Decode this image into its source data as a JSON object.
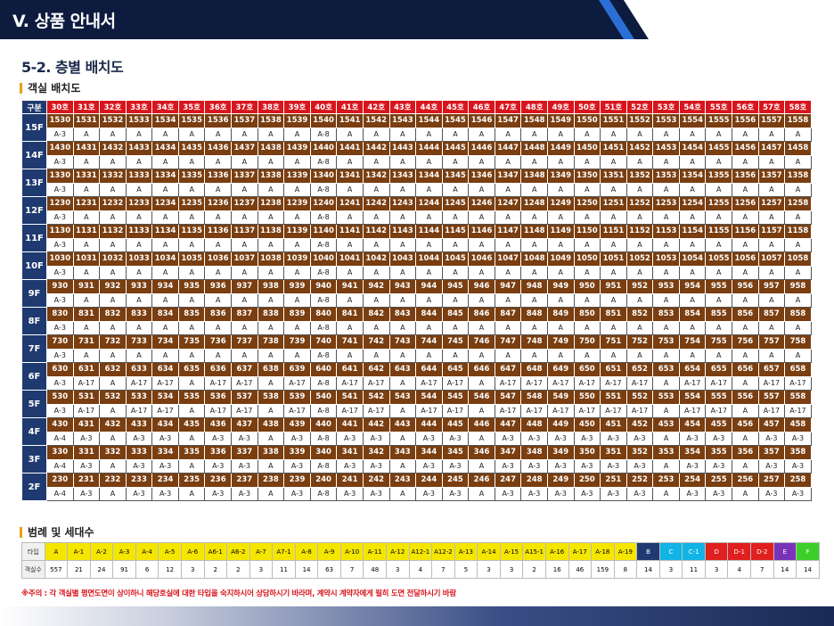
{
  "header": {
    "title": "V. 상품 안내서"
  },
  "section_title": "5-2. 층별 배치도",
  "sub_title": "객실 배치도",
  "grid": {
    "corner_label": "구분",
    "columns": [
      "30호",
      "31호",
      "32호",
      "33호",
      "34호",
      "35호",
      "36호",
      "37호",
      "38호",
      "39호",
      "40호",
      "41호",
      "42호",
      "43호",
      "44호",
      "45호",
      "46호",
      "47호",
      "48호",
      "49호",
      "50호",
      "51호",
      "52호",
      "53호",
      "54호",
      "55호",
      "56호",
      "57호",
      "58호"
    ],
    "floors": [
      {
        "floor": "15F",
        "rooms": [
          "1530",
          "1531",
          "1532",
          "1533",
          "1534",
          "1535",
          "1536",
          "1537",
          "1538",
          "1539",
          "1540",
          "1541",
          "1542",
          "1543",
          "1544",
          "1545",
          "1546",
          "1547",
          "1548",
          "1549",
          "1550",
          "1551",
          "1552",
          "1553",
          "1554",
          "1555",
          "1556",
          "1557",
          "1558"
        ],
        "types": [
          "A-3",
          "A",
          "A",
          "A",
          "A",
          "A",
          "A",
          "A",
          "A",
          "A",
          "A-8",
          "A",
          "A",
          "A",
          "A",
          "A",
          "A",
          "A",
          "A",
          "A",
          "A",
          "A",
          "A",
          "A",
          "A",
          "A",
          "A",
          "A",
          "A"
        ]
      },
      {
        "floor": "14F",
        "rooms": [
          "1430",
          "1431",
          "1432",
          "1433",
          "1434",
          "1435",
          "1436",
          "1437",
          "1438",
          "1439",
          "1440",
          "1441",
          "1442",
          "1443",
          "1444",
          "1445",
          "1446",
          "1447",
          "1448",
          "1449",
          "1450",
          "1451",
          "1452",
          "1453",
          "1454",
          "1455",
          "1456",
          "1457",
          "1458"
        ],
        "types": [
          "A-3",
          "A",
          "A",
          "A",
          "A",
          "A",
          "A",
          "A",
          "A",
          "A",
          "A-8",
          "A",
          "A",
          "A",
          "A",
          "A",
          "A",
          "A",
          "A",
          "A",
          "A",
          "A",
          "A",
          "A",
          "A",
          "A",
          "A",
          "A",
          "A"
        ]
      },
      {
        "floor": "13F",
        "rooms": [
          "1330",
          "1331",
          "1332",
          "1333",
          "1334",
          "1335",
          "1336",
          "1337",
          "1338",
          "1339",
          "1340",
          "1341",
          "1342",
          "1343",
          "1344",
          "1345",
          "1346",
          "1347",
          "1348",
          "1349",
          "1350",
          "1351",
          "1352",
          "1353",
          "1354",
          "1355",
          "1356",
          "1357",
          "1358"
        ],
        "types": [
          "A-3",
          "A",
          "A",
          "A",
          "A",
          "A",
          "A",
          "A",
          "A",
          "A",
          "A-8",
          "A",
          "A",
          "A",
          "A",
          "A",
          "A",
          "A",
          "A",
          "A",
          "A",
          "A",
          "A",
          "A",
          "A",
          "A",
          "A",
          "A",
          "A"
        ]
      },
      {
        "floor": "12F",
        "rooms": [
          "1230",
          "1231",
          "1232",
          "1233",
          "1234",
          "1235",
          "1236",
          "1237",
          "1238",
          "1239",
          "1240",
          "1241",
          "1242",
          "1243",
          "1244",
          "1245",
          "1246",
          "1247",
          "1248",
          "1249",
          "1250",
          "1251",
          "1252",
          "1253",
          "1254",
          "1255",
          "1256",
          "1257",
          "1258"
        ],
        "types": [
          "A-3",
          "A",
          "A",
          "A",
          "A",
          "A",
          "A",
          "A",
          "A",
          "A",
          "A-8",
          "A",
          "A",
          "A",
          "A",
          "A",
          "A",
          "A",
          "A",
          "A",
          "A",
          "A",
          "A",
          "A",
          "A",
          "A",
          "A",
          "A",
          "A"
        ]
      },
      {
        "floor": "11F",
        "rooms": [
          "1130",
          "1131",
          "1132",
          "1133",
          "1134",
          "1135",
          "1136",
          "1137",
          "1138",
          "1139",
          "1140",
          "1141",
          "1142",
          "1143",
          "1144",
          "1145",
          "1146",
          "1147",
          "1148",
          "1149",
          "1150",
          "1151",
          "1152",
          "1153",
          "1154",
          "1155",
          "1156",
          "1157",
          "1158"
        ],
        "types": [
          "A-3",
          "A",
          "A",
          "A",
          "A",
          "A",
          "A",
          "A",
          "A",
          "A",
          "A-8",
          "A",
          "A",
          "A",
          "A",
          "A",
          "A",
          "A",
          "A",
          "A",
          "A",
          "A",
          "A",
          "A",
          "A",
          "A",
          "A",
          "A",
          "A"
        ]
      },
      {
        "floor": "10F",
        "rooms": [
          "1030",
          "1031",
          "1032",
          "1033",
          "1034",
          "1035",
          "1036",
          "1037",
          "1038",
          "1039",
          "1040",
          "1041",
          "1042",
          "1043",
          "1044",
          "1045",
          "1046",
          "1047",
          "1048",
          "1049",
          "1050",
          "1051",
          "1052",
          "1053",
          "1054",
          "1055",
          "1056",
          "1057",
          "1058"
        ],
        "types": [
          "A-3",
          "A",
          "A",
          "A",
          "A",
          "A",
          "A",
          "A",
          "A",
          "A",
          "A-8",
          "A",
          "A",
          "A",
          "A",
          "A",
          "A",
          "A",
          "A",
          "A",
          "A",
          "A",
          "A",
          "A",
          "A",
          "A",
          "A",
          "A",
          "A"
        ]
      },
      {
        "floor": "9F",
        "rooms": [
          "930",
          "931",
          "932",
          "933",
          "934",
          "935",
          "936",
          "937",
          "938",
          "939",
          "940",
          "941",
          "942",
          "943",
          "944",
          "945",
          "946",
          "947",
          "948",
          "949",
          "950",
          "951",
          "952",
          "953",
          "954",
          "955",
          "956",
          "957",
          "958"
        ],
        "types": [
          "A-3",
          "A",
          "A",
          "A",
          "A",
          "A",
          "A",
          "A",
          "A",
          "A",
          "A-8",
          "A",
          "A",
          "A",
          "A",
          "A",
          "A",
          "A",
          "A",
          "A",
          "A",
          "A",
          "A",
          "A",
          "A",
          "A",
          "A",
          "A",
          "A"
        ]
      },
      {
        "floor": "8F",
        "rooms": [
          "830",
          "831",
          "832",
          "833",
          "834",
          "835",
          "836",
          "837",
          "838",
          "839",
          "840",
          "841",
          "842",
          "843",
          "844",
          "845",
          "846",
          "847",
          "848",
          "849",
          "850",
          "851",
          "852",
          "853",
          "854",
          "855",
          "856",
          "857",
          "858"
        ],
        "types": [
          "A-3",
          "A",
          "A",
          "A",
          "A",
          "A",
          "A",
          "A",
          "A",
          "A",
          "A-8",
          "A",
          "A",
          "A",
          "A",
          "A",
          "A",
          "A",
          "A",
          "A",
          "A",
          "A",
          "A",
          "A",
          "A",
          "A",
          "A",
          "A",
          "A"
        ]
      },
      {
        "floor": "7F",
        "rooms": [
          "730",
          "731",
          "732",
          "733",
          "734",
          "735",
          "736",
          "737",
          "738",
          "739",
          "740",
          "741",
          "742",
          "743",
          "744",
          "745",
          "746",
          "747",
          "748",
          "749",
          "750",
          "751",
          "752",
          "753",
          "754",
          "755",
          "756",
          "757",
          "758"
        ],
        "types": [
          "A-3",
          "A",
          "A",
          "A",
          "A",
          "A",
          "A",
          "A",
          "A",
          "A",
          "A-8",
          "A",
          "A",
          "A",
          "A",
          "A",
          "A",
          "A",
          "A",
          "A",
          "A",
          "A",
          "A",
          "A",
          "A",
          "A",
          "A",
          "A",
          "A"
        ]
      },
      {
        "floor": "6F",
        "rooms": [
          "630",
          "631",
          "632",
          "633",
          "634",
          "635",
          "636",
          "637",
          "638",
          "639",
          "640",
          "641",
          "642",
          "643",
          "644",
          "645",
          "646",
          "647",
          "648",
          "649",
          "650",
          "651",
          "652",
          "653",
          "654",
          "655",
          "656",
          "657",
          "658"
        ],
        "types": [
          "A-3",
          "A-17",
          "A",
          "A-17",
          "A-17",
          "A",
          "A-17",
          "A-17",
          "A",
          "A-17",
          "A-8",
          "A-17",
          "A-17",
          "A",
          "A-17",
          "A-17",
          "A",
          "A-17",
          "A-17",
          "A-17",
          "A-17",
          "A-17",
          "A-17",
          "A",
          "A-17",
          "A-17",
          "A",
          "A-17",
          "A-17"
        ]
      },
      {
        "floor": "5F",
        "rooms": [
          "530",
          "531",
          "532",
          "533",
          "534",
          "535",
          "536",
          "537",
          "538",
          "539",
          "540",
          "541",
          "542",
          "543",
          "544",
          "545",
          "546",
          "547",
          "548",
          "549",
          "550",
          "551",
          "552",
          "553",
          "554",
          "555",
          "556",
          "557",
          "558"
        ],
        "types": [
          "A-3",
          "A-17",
          "A",
          "A-17",
          "A-17",
          "A",
          "A-17",
          "A-17",
          "A",
          "A-17",
          "A-8",
          "A-17",
          "A-17",
          "A",
          "A-17",
          "A-17",
          "A",
          "A-17",
          "A-17",
          "A-17",
          "A-17",
          "A-17",
          "A-17",
          "A",
          "A-17",
          "A-17",
          "A",
          "A-17",
          "A-17"
        ]
      },
      {
        "floor": "4F",
        "rooms": [
          "430",
          "431",
          "432",
          "433",
          "434",
          "435",
          "436",
          "437",
          "438",
          "439",
          "440",
          "441",
          "442",
          "443",
          "444",
          "445",
          "446",
          "447",
          "448",
          "449",
          "450",
          "451",
          "452",
          "453",
          "454",
          "455",
          "456",
          "457",
          "458"
        ],
        "types": [
          "A-4",
          "A-3",
          "A",
          "A-3",
          "A-3",
          "A",
          "A-3",
          "A-3",
          "A",
          "A-3",
          "A-8",
          "A-3",
          "A-3",
          "A",
          "A-3",
          "A-3",
          "A",
          "A-3",
          "A-3",
          "A-3",
          "A-3",
          "A-3",
          "A-3",
          "A",
          "A-3",
          "A-3",
          "A",
          "A-3",
          "A-3"
        ]
      },
      {
        "floor": "3F",
        "rooms": [
          "330",
          "331",
          "332",
          "333",
          "334",
          "335",
          "336",
          "337",
          "338",
          "339",
          "340",
          "341",
          "342",
          "343",
          "344",
          "345",
          "346",
          "347",
          "348",
          "349",
          "350",
          "351",
          "352",
          "353",
          "354",
          "355",
          "356",
          "357",
          "358"
        ],
        "types": [
          "A-4",
          "A-3",
          "A",
          "A-3",
          "A-3",
          "A",
          "A-3",
          "A-3",
          "A",
          "A-3",
          "A-8",
          "A-3",
          "A-3",
          "A",
          "A-3",
          "A-3",
          "A",
          "A-3",
          "A-3",
          "A-3",
          "A-3",
          "A-3",
          "A-3",
          "A",
          "A-3",
          "A-3",
          "A",
          "A-3",
          "A-3"
        ]
      },
      {
        "floor": "2F",
        "rooms": [
          "230",
          "231",
          "232",
          "233",
          "234",
          "235",
          "236",
          "237",
          "238",
          "239",
          "240",
          "241",
          "242",
          "243",
          "244",
          "245",
          "246",
          "247",
          "248",
          "249",
          "250",
          "251",
          "252",
          "253",
          "254",
          "255",
          "256",
          "257",
          "258"
        ],
        "types": [
          "A-4",
          "A-3",
          "A",
          "A-3",
          "A-3",
          "A",
          "A-3",
          "A-3",
          "A",
          "A-3",
          "A-8",
          "A-3",
          "A-3",
          "A",
          "A-3",
          "A-3",
          "A",
          "A-3",
          "A-3",
          "A-3",
          "A-3",
          "A-3",
          "A-3",
          "A",
          "A-3",
          "A-3",
          "A",
          "A-3",
          "A-3"
        ]
      }
    ]
  },
  "legend": {
    "title": "범례 및 세대수",
    "type_label": "타입",
    "count_label": "객실수",
    "types": [
      "A",
      "A-1",
      "A-2",
      "A-3",
      "A-4",
      "A-5",
      "A-6",
      "A6-1",
      "A6-2",
      "A-7",
      "A7-1",
      "A-8",
      "A-9",
      "A-10",
      "A-11",
      "A-12",
      "A12-1",
      "A12-2",
      "A-13",
      "A-14",
      "A-15",
      "A15-1",
      "A-16",
      "A-17",
      "A-18",
      "A-19",
      "B",
      "C",
      "C-1",
      "D",
      "D-1",
      "D-2",
      "E",
      "F"
    ],
    "counts": [
      "557",
      "21",
      "24",
      "91",
      "6",
      "12",
      "3",
      "2",
      "2",
      "3",
      "11",
      "14",
      "63",
      "7",
      "48",
      "3",
      "4",
      "7",
      "5",
      "3",
      "3",
      "2",
      "16",
      "46",
      "159",
      "8",
      "14",
      "3",
      "11",
      "3",
      "4",
      "7",
      "14",
      "14"
    ],
    "colors": [
      "#f5e600",
      "#f5e600",
      "#f5e600",
      "#f5e600",
      "#f5e600",
      "#f5e600",
      "#f5e600",
      "#f5e600",
      "#f5e600",
      "#f5e600",
      "#f5e600",
      "#f5e600",
      "#f5e600",
      "#f5e600",
      "#f5e600",
      "#f5e600",
      "#f5e600",
      "#f5e600",
      "#f5e600",
      "#f5e600",
      "#f5e600",
      "#f5e600",
      "#f5e600",
      "#f5e600",
      "#f5e600",
      "#f5e600",
      "#1f3a70",
      "#12b4e6",
      "#12b4e6",
      "#e01f1f",
      "#e01f1f",
      "#e01f1f",
      "#7a33b8",
      "#3ccf2a"
    ],
    "text_colors": [
      "#000",
      "#000",
      "#000",
      "#000",
      "#000",
      "#000",
      "#000",
      "#000",
      "#000",
      "#000",
      "#000",
      "#000",
      "#000",
      "#000",
      "#000",
      "#000",
      "#000",
      "#000",
      "#000",
      "#000",
      "#000",
      "#000",
      "#000",
      "#000",
      "#000",
      "#000",
      "#fff",
      "#fff",
      "#fff",
      "#fff",
      "#fff",
      "#fff",
      "#fff",
      "#fff"
    ]
  },
  "note": "※주의 : 각 객실별 평면도면이 상이하니 해당호실에 대한 타입을 숙지하시어 상담하시기 바라며, 계약시 계약자에게 필히 도면 전달하시기 바람",
  "colors": {
    "header_bg": "#0d1b3e",
    "column_header": "#d9151c",
    "floor_label": "#1f3a70",
    "room_row": "#7a3e10"
  }
}
